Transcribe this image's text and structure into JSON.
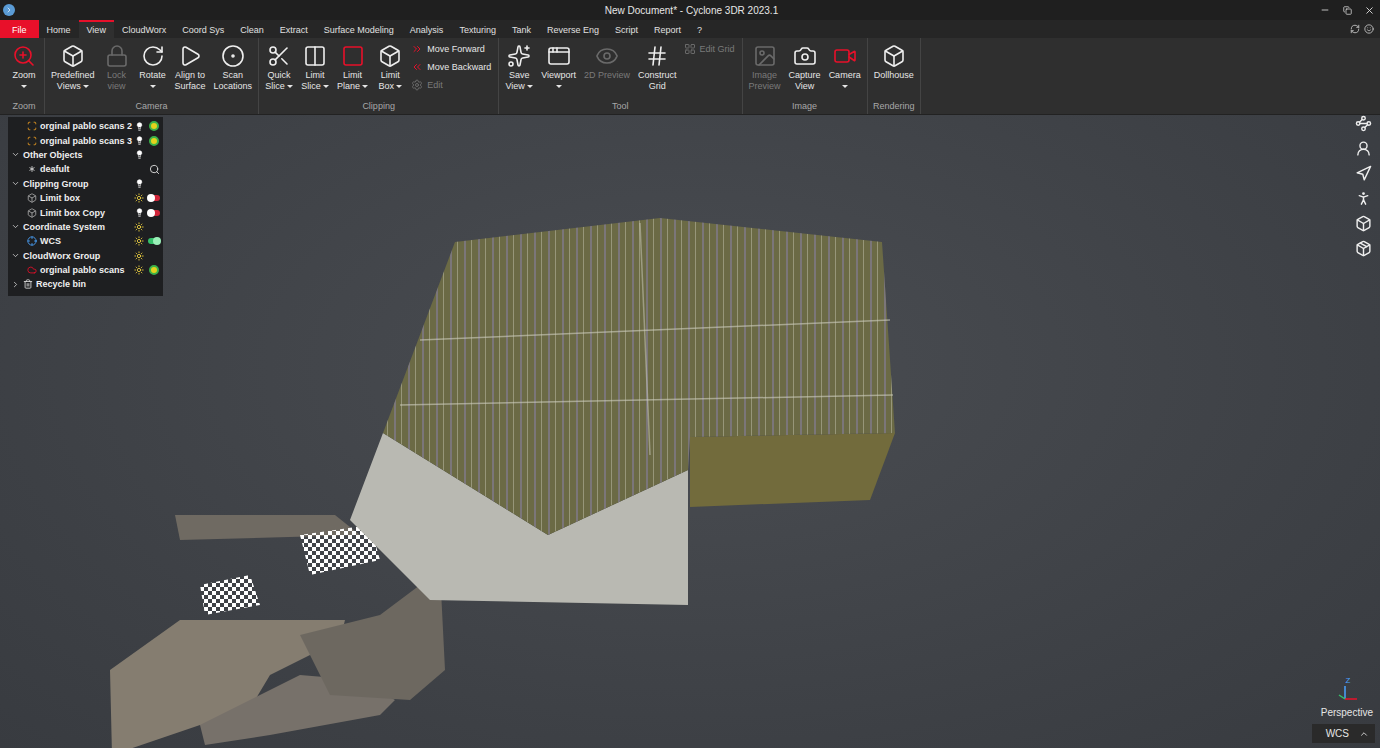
{
  "window": {
    "title": "New Document* - Cyclone 3DR 2023.1"
  },
  "menu_tabs": [
    {
      "label": "File",
      "selected": false,
      "kind": "file"
    },
    {
      "label": "Home",
      "selected": false,
      "kind": "tab"
    },
    {
      "label": "View",
      "selected": true,
      "kind": "tab"
    },
    {
      "label": "CloudWorx",
      "selected": false,
      "kind": "tab"
    },
    {
      "label": "Coord Sys",
      "selected": false,
      "kind": "tab"
    },
    {
      "label": "Clean",
      "selected": false,
      "kind": "tab"
    },
    {
      "label": "Extract",
      "selected": false,
      "kind": "tab"
    },
    {
      "label": "Surface Modeling",
      "selected": false,
      "kind": "tab"
    },
    {
      "label": "Analysis",
      "selected": false,
      "kind": "tab"
    },
    {
      "label": "Texturing",
      "selected": false,
      "kind": "tab"
    },
    {
      "label": "Tank",
      "selected": false,
      "kind": "tab"
    },
    {
      "label": "Reverse Eng",
      "selected": false,
      "kind": "tab"
    },
    {
      "label": "Script",
      "selected": false,
      "kind": "tab"
    },
    {
      "label": "Report",
      "selected": false,
      "kind": "tab"
    },
    {
      "label": "?",
      "selected": false,
      "kind": "tab"
    }
  ],
  "ribbon_groups": [
    {
      "label": "Zoom",
      "buttons": [
        {
          "lines": [
            "Zoom"
          ],
          "dropdown": true,
          "disabled": false,
          "kind": "large"
        }
      ]
    },
    {
      "label": "Camera",
      "buttons": [
        {
          "lines": [
            "Predefined",
            "Views"
          ],
          "dropdown": true,
          "disabled": false,
          "kind": "large"
        },
        {
          "lines": [
            "Lock",
            "view"
          ],
          "dropdown": false,
          "disabled": true,
          "kind": "large"
        },
        {
          "lines": [
            "Rotate"
          ],
          "dropdown": true,
          "disabled": false,
          "kind": "large"
        },
        {
          "lines": [
            "Align to",
            "Surface"
          ],
          "dropdown": false,
          "disabled": false,
          "kind": "large"
        },
        {
          "lines": [
            "Scan",
            "Locations"
          ],
          "dropdown": false,
          "disabled": false,
          "kind": "large"
        }
      ]
    },
    {
      "label": "Clipping",
      "buttons": [
        {
          "lines": [
            "Quick",
            "Slice"
          ],
          "dropdown": true,
          "disabled": false,
          "kind": "large"
        },
        {
          "lines": [
            "Limit",
            "Slice"
          ],
          "dropdown": true,
          "disabled": false,
          "kind": "large"
        },
        {
          "lines": [
            "Limit",
            "Plane"
          ],
          "dropdown": true,
          "disabled": false,
          "kind": "large"
        },
        {
          "lines": [
            "Limit",
            "Box"
          ],
          "dropdown": true,
          "disabled": false,
          "kind": "large"
        },
        {
          "lines": [
            "Move Forward"
          ],
          "dropdown": false,
          "disabled": false,
          "kind": "small"
        },
        {
          "lines": [
            "Move Backward"
          ],
          "dropdown": false,
          "disabled": false,
          "kind": "small"
        },
        {
          "lines": [
            "Edit"
          ],
          "dropdown": false,
          "disabled": true,
          "kind": "small"
        }
      ]
    },
    {
      "label": "Tool",
      "buttons": [
        {
          "lines": [
            "Save",
            "View"
          ],
          "dropdown": true,
          "disabled": false,
          "kind": "large"
        },
        {
          "lines": [
            "Viewport"
          ],
          "dropdown": true,
          "disabled": false,
          "kind": "large"
        },
        {
          "lines": [
            "2D Preview"
          ],
          "dropdown": false,
          "disabled": true,
          "kind": "large"
        },
        {
          "lines": [
            "Construct",
            "Grid"
          ],
          "dropdown": false,
          "disabled": false,
          "kind": "large"
        },
        {
          "lines": [
            "Edit Grid"
          ],
          "dropdown": false,
          "disabled": true,
          "kind": "small"
        }
      ]
    },
    {
      "label": "Image",
      "buttons": [
        {
          "lines": [
            "Image",
            "Preview"
          ],
          "dropdown": false,
          "disabled": true,
          "kind": "large"
        },
        {
          "lines": [
            "Capture",
            "View"
          ],
          "dropdown": false,
          "disabled": false,
          "kind": "large"
        },
        {
          "lines": [
            "Camera"
          ],
          "dropdown": true,
          "disabled": false,
          "kind": "large"
        }
      ]
    },
    {
      "label": "Rendering",
      "buttons": [
        {
          "lines": [
            "Dollhouse"
          ],
          "dropdown": false,
          "disabled": false,
          "kind": "large"
        }
      ]
    }
  ],
  "tree": [
    {
      "label": "orginal pablo scans 2",
      "kind": "scan",
      "depth": 1,
      "expanded": false,
      "lamp": "bulb",
      "badge": "status"
    },
    {
      "label": "orginal pablo scans 3",
      "kind": "scan",
      "depth": 1,
      "expanded": false,
      "lamp": "bulb",
      "badge": "status"
    },
    {
      "label": "Other Objects",
      "kind": "group",
      "depth": 0,
      "expanded": true,
      "lamp": "bulb",
      "badge": "none"
    },
    {
      "label": "deafult",
      "kind": "object",
      "depth": 1,
      "expanded": false,
      "lamp": "none",
      "badge": "search"
    },
    {
      "label": "Clipping Group",
      "kind": "group",
      "depth": 0,
      "expanded": true,
      "lamp": "bulb",
      "badge": "none"
    },
    {
      "label": "Limit box",
      "kind": "clip",
      "depth": 1,
      "expanded": false,
      "lamp": "sun",
      "badge": "toggle",
      "on": false
    },
    {
      "label": "Limit box Copy",
      "kind": "clip",
      "depth": 1,
      "expanded": false,
      "lamp": "bulb",
      "badge": "toggle",
      "on": false
    },
    {
      "label": "Coordinate System",
      "kind": "group",
      "depth": 0,
      "expanded": true,
      "lamp": "sun",
      "badge": "none"
    },
    {
      "label": "WCS",
      "kind": "axes",
      "depth": 1,
      "expanded": false,
      "lamp": "sun",
      "badge": "toggle",
      "on": true
    },
    {
      "label": "CloudWorx Group",
      "kind": "group",
      "depth": 0,
      "expanded": true,
      "lamp": "sun",
      "badge": "none"
    },
    {
      "label": "orginal pablo scans",
      "kind": "cloud",
      "depth": 1,
      "expanded": false,
      "lamp": "sun",
      "badge": "status"
    },
    {
      "label": "Recycle bin",
      "kind": "bin",
      "depth": 0,
      "expanded": false,
      "lamp": "none",
      "badge": "none"
    }
  ],
  "viewport": {
    "axis_label": "Z",
    "projection": "Perspective",
    "coordinate_system": "WCS"
  }
}
